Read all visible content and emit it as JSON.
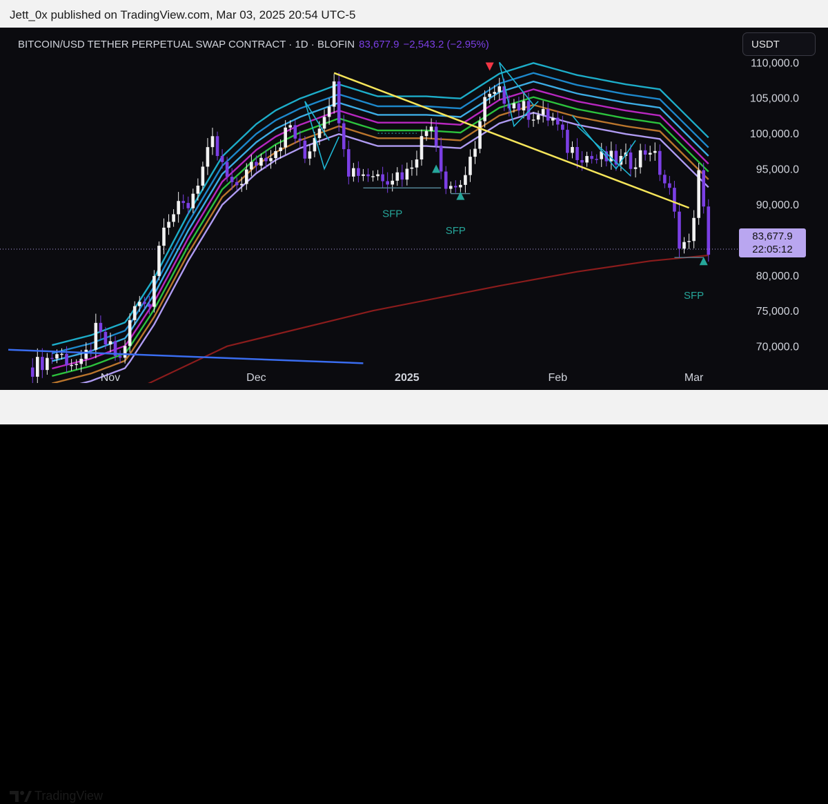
{
  "header": {
    "published_by": "Jett_0x published on TradingView.com, Mar 03, 2025 20:54 UTC-5"
  },
  "legend": {
    "symbol": "BITCOIN/USD TETHER PERPETUAL SWAP CONTRACT · 1D · BLOFIN",
    "last": "83,677.9",
    "change": "−2,543.2 (−2.95%)"
  },
  "currency_button": "USDT",
  "price_tag": {
    "price": "83,677.9",
    "countdown": "22:05:12"
  },
  "footer": {
    "brand": "TradingView"
  },
  "colors": {
    "background": "#0b0b0f",
    "bull_candle": "#f2f2f2",
    "bear_candle": "#7b3fe4",
    "trendline": "#f5e55a",
    "support_line": "#3a6df0",
    "ma_long": "#8b1c1c",
    "sfp_bull": "#26a69a",
    "sfp_bear": "#f23645",
    "swing_lines": "#1fb6d4",
    "last_price_tag": "#b9a6f0"
  },
  "chart_data": {
    "type": "candlestick",
    "timeframe": "1D",
    "y_axis": {
      "ticks": [
        70000,
        75000,
        80000,
        85000,
        90000,
        95000,
        100000,
        105000,
        110000
      ],
      "tick_labels": [
        "70,000.0",
        "75,000.0",
        "80,000.0",
        "85,000.0",
        "90,000.0",
        "95,000.0",
        "100,000.0",
        "105,000.0",
        "110,000.0"
      ],
      "range": [
        65300,
        111000
      ]
    },
    "x_axis": {
      "range": [
        "2024-10-11",
        "2025-03-09"
      ],
      "ticks": [
        {
          "date": "2024-11-01",
          "label": "Nov",
          "bold": false
        },
        {
          "date": "2024-12-01",
          "label": "Dec",
          "bold": false
        },
        {
          "date": "2025-01-01",
          "label": "2025",
          "bold": true
        },
        {
          "date": "2025-02-01",
          "label": "Feb",
          "bold": false
        },
        {
          "date": "2025-03-01",
          "label": "Mar",
          "bold": false
        }
      ]
    },
    "last_price": 83677.9,
    "price_path": [
      [
        "2024-10-16",
        67000
      ],
      [
        "2024-10-21",
        69000
      ],
      [
        "2024-10-26",
        67000
      ],
      [
        "2024-10-29",
        72000
      ],
      [
        "2024-11-03",
        68000
      ],
      [
        "2024-11-06",
        75500
      ],
      [
        "2024-11-09",
        76500
      ],
      [
        "2024-11-12",
        88000
      ],
      [
        "2024-11-17",
        90000
      ],
      [
        "2024-11-22",
        98500
      ],
      [
        "2024-11-26",
        92000
      ],
      [
        "2024-12-01",
        96000
      ],
      [
        "2024-12-05",
        98000
      ],
      [
        "2024-12-08",
        101000
      ],
      [
        "2024-12-11",
        96500
      ],
      [
        "2024-12-17",
        106500
      ],
      [
        "2024-12-20",
        95000
      ],
      [
        "2024-12-23",
        94500
      ],
      [
        "2024-12-28",
        94000
      ],
      [
        "2025-01-01",
        94500
      ],
      [
        "2025-01-06",
        102000
      ],
      [
        "2025-01-09",
        92500
      ],
      [
        "2025-01-13",
        93000
      ],
      [
        "2025-01-17",
        104500
      ],
      [
        "2025-01-20",
        105500
      ],
      [
        "2025-01-26",
        103000
      ],
      [
        "2025-01-31",
        102000
      ],
      [
        "2025-02-03",
        98000
      ],
      [
        "2025-02-08",
        96500
      ],
      [
        "2025-02-16",
        96000
      ],
      [
        "2025-02-20",
        98000
      ],
      [
        "2025-02-24",
        91500
      ],
      [
        "2025-02-26",
        85000
      ],
      [
        "2025-02-28",
        84000
      ],
      [
        "2025-03-02",
        94000
      ],
      [
        "2025-03-04",
        83678
      ]
    ],
    "ema_ribbon": {
      "colors": [
        "#1fb6d4",
        "#1f8fd6",
        "#3fb5f0",
        "#c229c9",
        "#2ecc40",
        "#c47b2e",
        "#b8a3ff"
      ],
      "base": [
        [
          "2024-10-20",
          65300
        ],
        [
          "2024-10-28",
          66700
        ],
        [
          "2024-11-04",
          68500
        ],
        [
          "2024-11-10",
          74000
        ],
        [
          "2024-11-17",
          82000
        ],
        [
          "2024-11-24",
          89000
        ],
        [
          "2024-12-01",
          92500
        ],
        [
          "2024-12-10",
          95500
        ],
        [
          "2024-12-18",
          97500
        ],
        [
          "2024-12-26",
          95800
        ],
        [
          "2025-01-05",
          95800
        ],
        [
          "2025-01-12",
          95500
        ],
        [
          "2025-01-20",
          99000
        ],
        [
          "2025-01-27",
          100500
        ],
        [
          "2025-02-05",
          98800
        ],
        [
          "2025-02-15",
          97500
        ],
        [
          "2025-02-22",
          96800
        ],
        [
          "2025-03-04",
          90000
        ]
      ]
    },
    "ma_long": [
      [
        "2024-11-05",
        63500
      ],
      [
        "2024-11-25",
        70000
      ],
      [
        "2024-12-25",
        75000
      ],
      [
        "2025-01-20",
        78500
      ],
      [
        "2025-02-05",
        80500
      ],
      [
        "2025-02-20",
        82000
      ],
      [
        "2025-03-04",
        82800
      ]
    ],
    "trendlines": [
      {
        "name": "descending-resistance",
        "from": [
          "2024-12-17",
          108500
        ],
        "to": [
          "2025-02-28",
          89500
        ]
      },
      {
        "name": "support",
        "from": [
          "2024-10-11",
          69500
        ],
        "to": [
          "2024-12-23",
          67600
        ]
      }
    ],
    "zigzag": [
      [
        [
          "2024-12-11",
          104500
        ],
        [
          "2024-12-16",
          99000
        ]
      ],
      [
        [
          "2024-12-11",
          104500
        ],
        [
          "2024-12-15",
          95000
        ],
        [
          "2024-12-18",
          99500
        ]
      ],
      [
        [
          "2025-01-20",
          110000
        ],
        [
          "2025-01-27",
          104000
        ]
      ],
      [
        [
          "2025-01-20",
          110000
        ],
        [
          "2025-01-23",
          101000
        ],
        [
          "2025-01-28",
          104500
        ]
      ],
      [
        [
          "2025-02-04",
          102500
        ],
        [
          "2025-02-13",
          95000
        ],
        [
          "2025-02-17",
          99000
        ]
      ],
      [
        [
          "2025-02-05",
          101000
        ],
        [
          "2025-02-16",
          94000
        ]
      ]
    ],
    "level_lines": [
      {
        "from": [
          "2024-12-26",
          100000
        ],
        "to": [
          "2025-01-03",
          100000
        ],
        "style": "dotted"
      },
      {
        "from": [
          "2024-12-23",
          92300
        ],
        "to": [
          "2025-01-08",
          92300
        ],
        "style": "solid"
      },
      {
        "from": [
          "2025-01-10",
          91500
        ],
        "to": [
          "2025-01-14",
          91500
        ],
        "style": "solid"
      },
      {
        "from": [
          "2025-02-25",
          82500
        ],
        "to": [
          "2025-03-03",
          82500
        ],
        "style": "solid"
      }
    ],
    "annotations": [
      {
        "label": "SFP",
        "date": "2024-12-29",
        "price": 88200,
        "type": "bullish",
        "color": "#26a69a"
      },
      {
        "label": "SFP",
        "date": "2025-01-11",
        "price": 85800,
        "type": "bullish",
        "color": "#26a69a"
      },
      {
        "label": "SFP",
        "date": "2025-03-01",
        "price": 76700,
        "type": "bullish",
        "color": "#26a69a"
      },
      {
        "label": "SFP",
        "date": "2025-01-18",
        "price": 111500,
        "type": "bearish",
        "color": "#f23645"
      }
    ],
    "markers": [
      {
        "type": "up-triangle",
        "date": "2025-01-12",
        "price": 91200,
        "color": "#26a69a"
      },
      {
        "type": "up-triangle",
        "date": "2025-01-07",
        "price": 95000,
        "color": "#26a69a"
      },
      {
        "type": "up-triangle",
        "date": "2025-03-03",
        "price": 82000,
        "color": "#26a69a"
      },
      {
        "type": "down-triangle",
        "date": "2025-01-18",
        "price": 109400,
        "color": "#f23645"
      }
    ]
  }
}
